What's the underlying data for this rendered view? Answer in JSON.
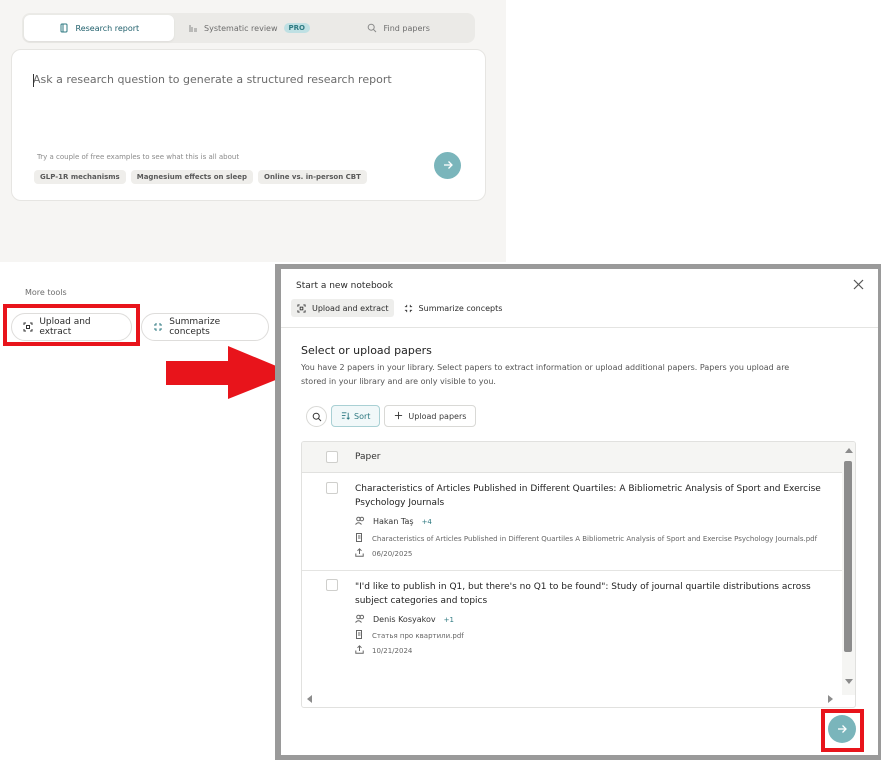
{
  "colors": {
    "accent": "#7ab5bb",
    "accent_text": "#2f7a82",
    "highlight_red": "#e8141b",
    "panel_bg": "#f6f5f3"
  },
  "mode_tabs": [
    {
      "label": "Research report",
      "icon": "book-icon",
      "active": true
    },
    {
      "label": "Systematic review",
      "icon": "chart-list-icon",
      "badge": "PRO",
      "active": false
    },
    {
      "label": "Find papers",
      "icon": "search-icon",
      "active": false
    }
  ],
  "question": {
    "placeholder": "Ask a research question to generate a structured research report",
    "examples_hint": "Try a couple of free examples to see what this is all about",
    "examples": [
      "GLP-1R mechanisms",
      "Magnesium effects on sleep",
      "Online vs. in-person CBT"
    ]
  },
  "more_tools": {
    "label": "More tools",
    "upload_extract": "Upload and extract",
    "summarize": "Summarize concepts"
  },
  "modal": {
    "title": "Start a new notebook",
    "tabs": [
      {
        "label": "Upload and extract",
        "icon": "scan-icon",
        "active": true
      },
      {
        "label": "Summarize concepts",
        "icon": "collapse-icon",
        "active": false
      }
    ],
    "section_title": "Select or upload papers",
    "section_desc": "You have 2 papers in your library. Select papers to extract information or upload additional papers. Papers you upload are stored in your library and are only visible to you.",
    "sort_label": "Sort",
    "upload_papers_label": "Upload papers",
    "table_header": "Paper",
    "papers": [
      {
        "title": "Characteristics of Articles Published in Different Quartiles: A Bibliometric Analysis of Sport and Exercise Psychology Journals",
        "author": "Hakan Taş",
        "more_authors": "+4",
        "file": "Characteristics of Articles Published in Different Quartiles A Bibliometric Analysis of Sport and Exercise Psychology Journals.pdf",
        "date": "06/20/2025"
      },
      {
        "title": "\"I'd like to publish in Q1, but there's no Q1 to be found\": Study of journal quartile distributions across subject categories and topics",
        "author": "Denis Kosyakov",
        "more_authors": "+1",
        "file": "Статья про квартили.pdf",
        "date": "10/21/2024"
      }
    ]
  }
}
